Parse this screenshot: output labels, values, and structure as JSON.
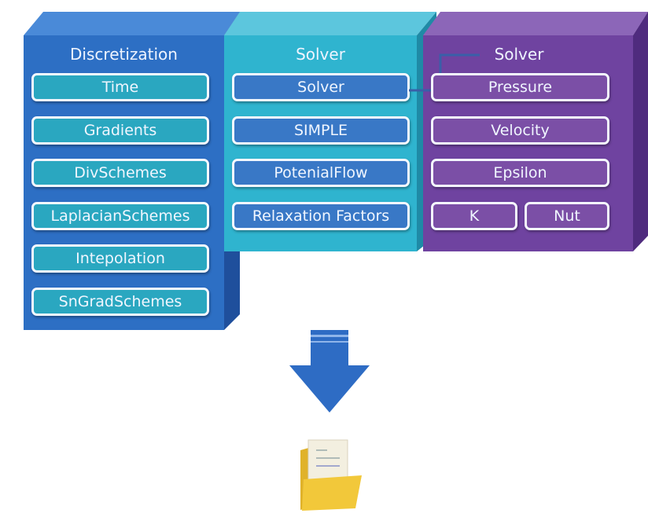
{
  "colors": {
    "discretization": "#2d6fc4",
    "solver": "#2fb4cf",
    "solver_settings": "#6f43a0",
    "arrow": "#2e6cc4",
    "folder": "#f2c83a"
  },
  "columns": [
    {
      "title": "Discretization",
      "items": [
        "Time",
        "Gradients",
        "DivSchemes",
        "LaplacianSchemes",
        "Intepolation",
        "SnGradSchemes"
      ]
    },
    {
      "title": "Solver",
      "items": [
        "Solver",
        "SIMPLE",
        "PotenialFlow",
        "Relaxation Factors"
      ]
    },
    {
      "title": "Solver",
      "items": [
        "Pressure",
        "Velocity",
        "Epsilon",
        "K",
        "Nut"
      ]
    }
  ],
  "icons": {
    "arrow": "arrow-down-icon",
    "output": "folder-document-icon"
  }
}
